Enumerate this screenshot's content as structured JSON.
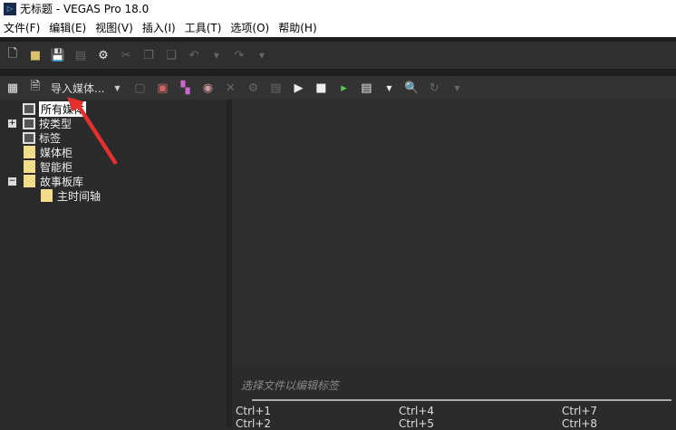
{
  "window": {
    "title": "无标题 - VEGAS Pro 18.0"
  },
  "menu": [
    "文件(F)",
    "编辑(E)",
    "视图(V)",
    "插入(I)",
    "工具(T)",
    "选项(O)",
    "帮助(H)"
  ],
  "toolbar2": {
    "import_label": "导入媒体..."
  },
  "tree": [
    {
      "label": "所有媒体",
      "type": "library",
      "selected": true
    },
    {
      "label": "按类型",
      "type": "library",
      "expander": "+"
    },
    {
      "label": "标签",
      "type": "library"
    },
    {
      "label": "媒体柜",
      "type": "folder"
    },
    {
      "label": "智能柜",
      "type": "folder"
    },
    {
      "label": "故事板库",
      "type": "folder",
      "expander": "−"
    },
    {
      "label": "主时间轴",
      "type": "folder",
      "indent": true
    }
  ],
  "tags": {
    "hint": "选择文件以编辑标签",
    "shortcuts": [
      "Ctrl+1",
      "Ctrl+2",
      "Ctrl+4",
      "Ctrl+5",
      "Ctrl+7",
      "Ctrl+8"
    ]
  }
}
